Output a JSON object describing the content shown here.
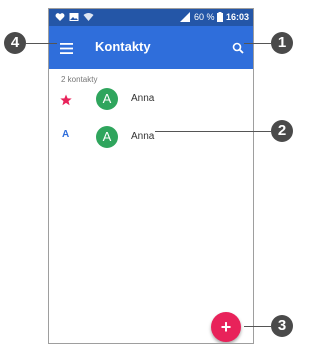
{
  "status_bar": {
    "left_icons": [
      "heart-icon",
      "image-icon",
      "wifi-icon"
    ],
    "signal": "signal-icon",
    "battery_percent": "60 %",
    "battery_icon": "battery-icon",
    "time": "16:03"
  },
  "app_bar": {
    "menu_icon": "menu-icon",
    "title": "Kontakty",
    "search_icon": "search-icon"
  },
  "contacts": {
    "count_label": "2 kontakty",
    "items": [
      {
        "marker": "★",
        "marker_icon": "star-icon",
        "avatar_letter": "A",
        "name": "Anna"
      },
      {
        "marker": "A",
        "avatar_letter": "A",
        "name": "Anna"
      }
    ]
  },
  "fab": {
    "label": "+"
  },
  "callouts": {
    "one": "1",
    "two": "2",
    "three": "3",
    "four": "4"
  },
  "colors": {
    "app_bar": "#2f6edb",
    "status_bar": "#2456a7",
    "avatar": "#2fa55d",
    "fab": "#e8225a",
    "star": "#e8225a",
    "letter_marker": "#2f6edb"
  }
}
